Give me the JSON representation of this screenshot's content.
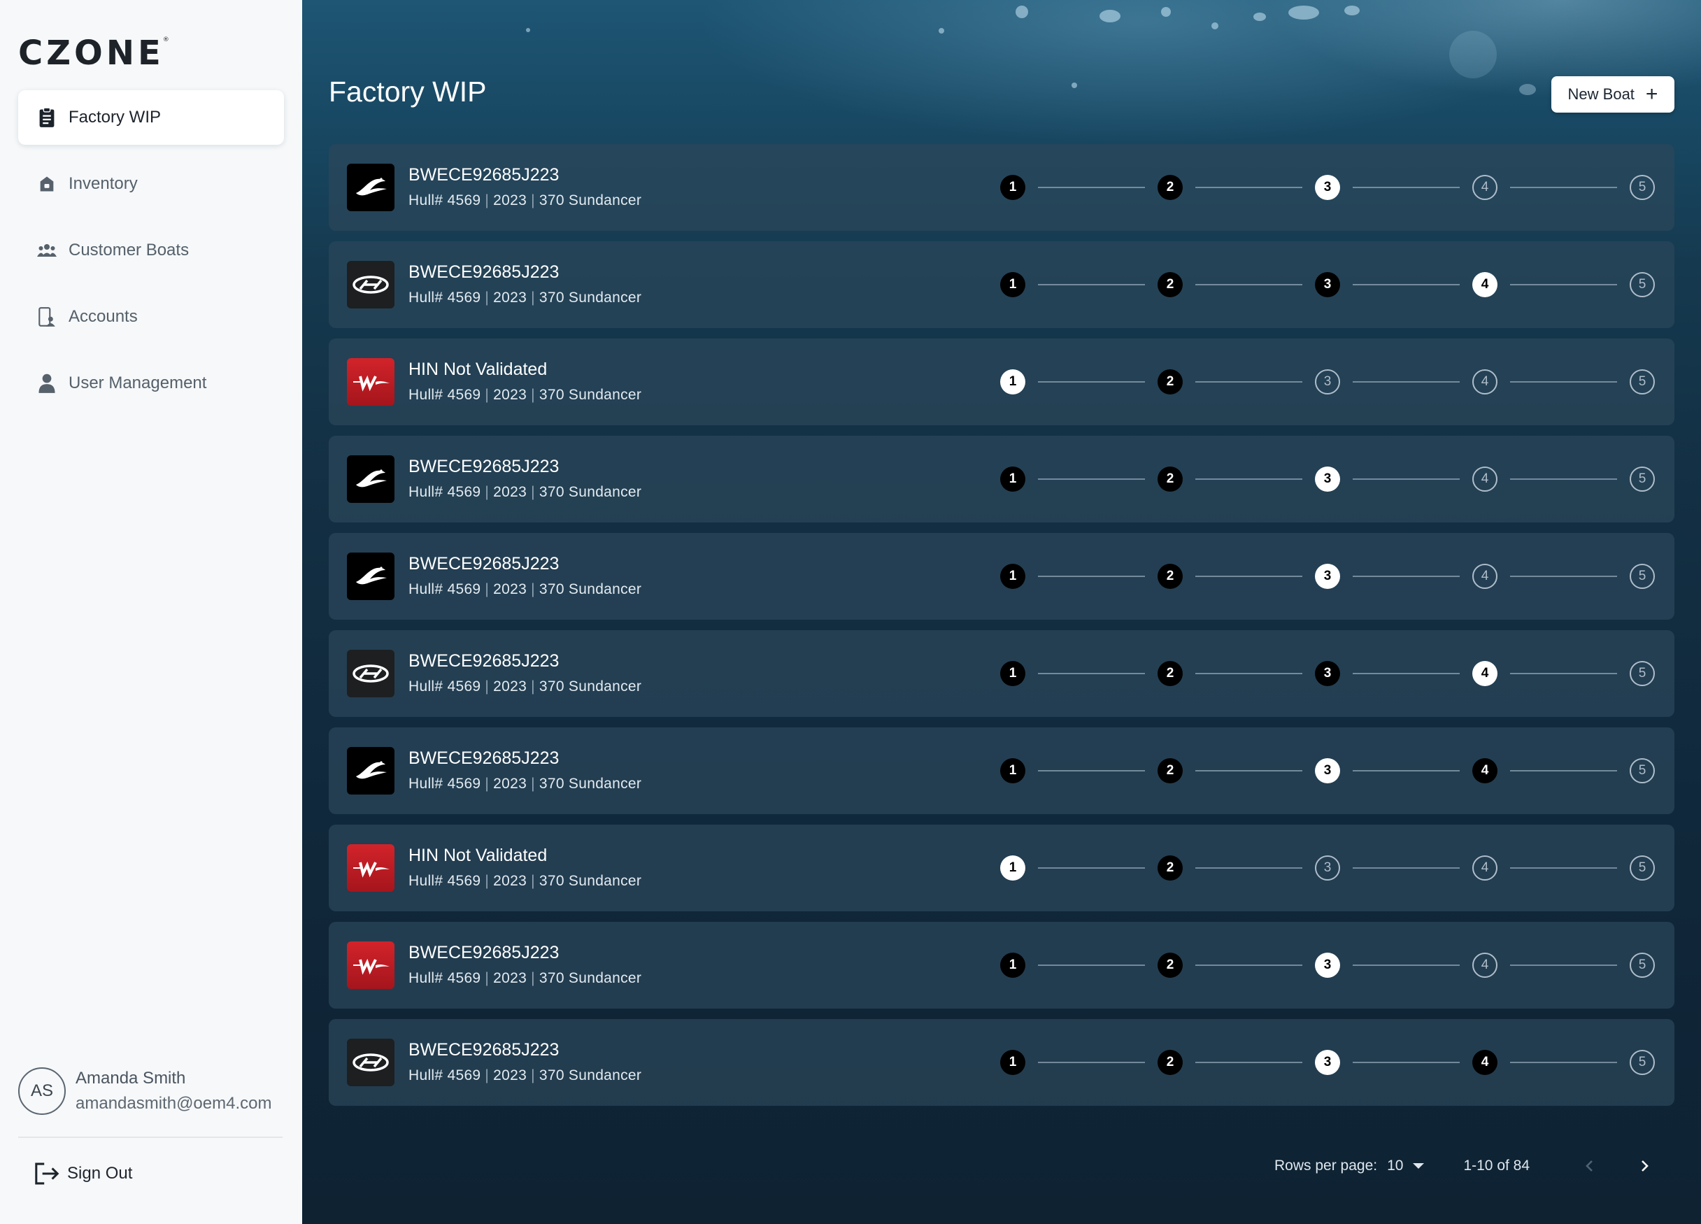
{
  "app": {
    "brand": "CZONE",
    "brand_mark": "®"
  },
  "sidebar": {
    "items": [
      {
        "label": "Factory WIP",
        "icon": "clipboard-icon",
        "active": true
      },
      {
        "label": "Inventory",
        "icon": "shopping-bag-icon",
        "active": false
      },
      {
        "label": "Customer Boats",
        "icon": "users-icon",
        "active": false
      },
      {
        "label": "Accounts",
        "icon": "device-user-icon",
        "active": false
      },
      {
        "label": "User Management",
        "icon": "person-icon",
        "active": false
      }
    ],
    "user": {
      "initials": "AS",
      "name": "Amanda Smith",
      "email": "amandasmith@oem4.com"
    },
    "sign_out": "Sign Out"
  },
  "main": {
    "title": "Factory WIP",
    "new_boat_label": "New Boat",
    "new_boat_icon": "+",
    "boats": [
      {
        "brand": "ribbon-logo",
        "title": "BWECE92685J223",
        "hull": "Hull# 4569",
        "year": "2023",
        "model": "370 Sundancer",
        "step": 3
      },
      {
        "brand": "oval-logo",
        "title": "BWECE92685J223",
        "hull": "Hull# 4569",
        "year": "2023",
        "model": "370 Sundancer",
        "step": 4
      },
      {
        "brand": "w-logo",
        "title": "HIN Not Validated",
        "hull": "Hull# 4569",
        "year": "2023",
        "model": "370 Sundancer",
        "step": 1
      },
      {
        "brand": "ribbon-logo",
        "title": "BWECE92685J223",
        "hull": "Hull# 4569",
        "year": "2023",
        "model": "370 Sundancer",
        "step": 3
      },
      {
        "brand": "ribbon-logo",
        "title": "BWECE92685J223",
        "hull": "Hull# 4569",
        "year": "2023",
        "model": "370 Sundancer",
        "step": 3
      },
      {
        "brand": "oval-logo",
        "title": "BWECE92685J223",
        "hull": "Hull# 4569",
        "year": "2023",
        "model": "370 Sundancer",
        "step": 4
      },
      {
        "brand": "ribbon-logo",
        "title": "BWECE92685J223",
        "hull": "Hull# 4569",
        "year": "2023",
        "model": "370 Sundancer",
        "step": 3
      },
      {
        "brand": "w-logo",
        "title": "HIN Not Validated",
        "hull": "Hull# 4569",
        "year": "2023",
        "model": "370 Sundancer",
        "step": 1
      },
      {
        "brand": "w-logo",
        "title": "BWECE92685J223",
        "hull": "Hull# 4569",
        "year": "2023",
        "model": "370 Sundancer",
        "step": 3
      },
      {
        "brand": "oval-logo",
        "title": "BWECE92685J223",
        "hull": "Hull# 4569",
        "year": "2023",
        "model": "370 Sundancer",
        "step": 3
      }
    ],
    "step_states": [
      [
        "done",
        "done",
        "current",
        "pending",
        "pending"
      ],
      [
        "done",
        "done",
        "done",
        "current",
        "pending"
      ],
      [
        "current",
        "done",
        "pending",
        "pending",
        "pending"
      ],
      [
        "done",
        "done",
        "current",
        "pending",
        "pending"
      ],
      [
        "done",
        "done",
        "current",
        "pending",
        "pending"
      ],
      [
        "done",
        "done",
        "done",
        "current",
        "pending"
      ],
      [
        "done",
        "done",
        "current",
        "done",
        "pending"
      ],
      [
        "current",
        "done",
        "pending",
        "pending",
        "pending"
      ],
      [
        "done",
        "done",
        "current",
        "pending",
        "pending"
      ],
      [
        "done",
        "done",
        "current",
        "done",
        "pending"
      ]
    ],
    "step_labels": [
      "1",
      "2",
      "3",
      "4",
      "5"
    ],
    "separator": "|"
  },
  "pagination": {
    "rows_per_page_label": "Rows per page:",
    "rows_per_page_value": "10",
    "range": "1-10 of 84"
  }
}
